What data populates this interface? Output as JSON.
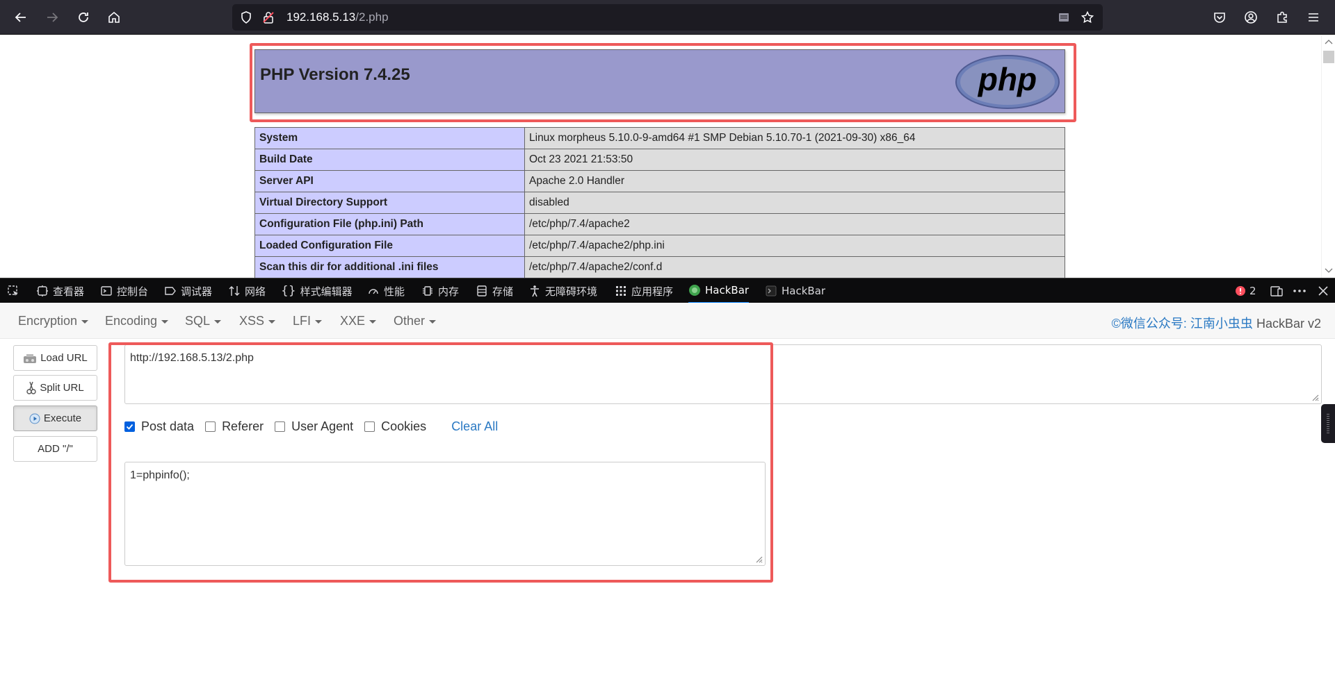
{
  "browser": {
    "url_host": "192.168.5.13",
    "url_path": "/2.php"
  },
  "phpinfo": {
    "title": "PHP Version 7.4.25",
    "logo_text": "php",
    "rows": [
      {
        "key": "System",
        "value": "Linux morpheus 5.10.0-9-amd64 #1 SMP Debian 5.10.70-1 (2021-09-30) x86_64"
      },
      {
        "key": "Build Date",
        "value": "Oct 23 2021 21:53:50"
      },
      {
        "key": "Server API",
        "value": "Apache 2.0 Handler"
      },
      {
        "key": "Virtual Directory Support",
        "value": "disabled"
      },
      {
        "key": "Configuration File (php.ini) Path",
        "value": "/etc/php/7.4/apache2"
      },
      {
        "key": "Loaded Configuration File",
        "value": "/etc/php/7.4/apache2/php.ini"
      },
      {
        "key": "Scan this dir for additional .ini files",
        "value": "/etc/php/7.4/apache2/conf.d"
      }
    ]
  },
  "devtools": {
    "tabs": [
      "查看器",
      "控制台",
      "调试器",
      "网络",
      "样式编辑器",
      "性能",
      "内存",
      "存储",
      "无障碍环境",
      "应用程序",
      "HackBar",
      "HackBar"
    ],
    "active_tab": "HackBar",
    "error_count": "2"
  },
  "hackbar": {
    "menu": [
      "Encryption",
      "Encoding",
      "SQL",
      "XSS",
      "LFI",
      "XXE",
      "Other"
    ],
    "credit": "©微信公众号: 江南小虫虫",
    "version": "HackBar v2",
    "buttons": {
      "load_url": "Load URL",
      "split_url": "Split URL",
      "execute": "Execute",
      "add_slash": "ADD \"/\""
    },
    "url_value": "http://192.168.5.13/2.php",
    "options": {
      "post_data": "Post data",
      "referer": "Referer",
      "user_agent": "User Agent",
      "cookies": "Cookies",
      "clear_all": "Clear All"
    },
    "post_data_checked": true,
    "post_value": "1=phpinfo();"
  },
  "colors": {
    "highlight_border": "#ee5a5a",
    "php_header_bg": "#9999cc",
    "php_key_bg": "#ccccff",
    "php_value_bg": "#dddddd",
    "link_blue": "#2a79c3"
  }
}
